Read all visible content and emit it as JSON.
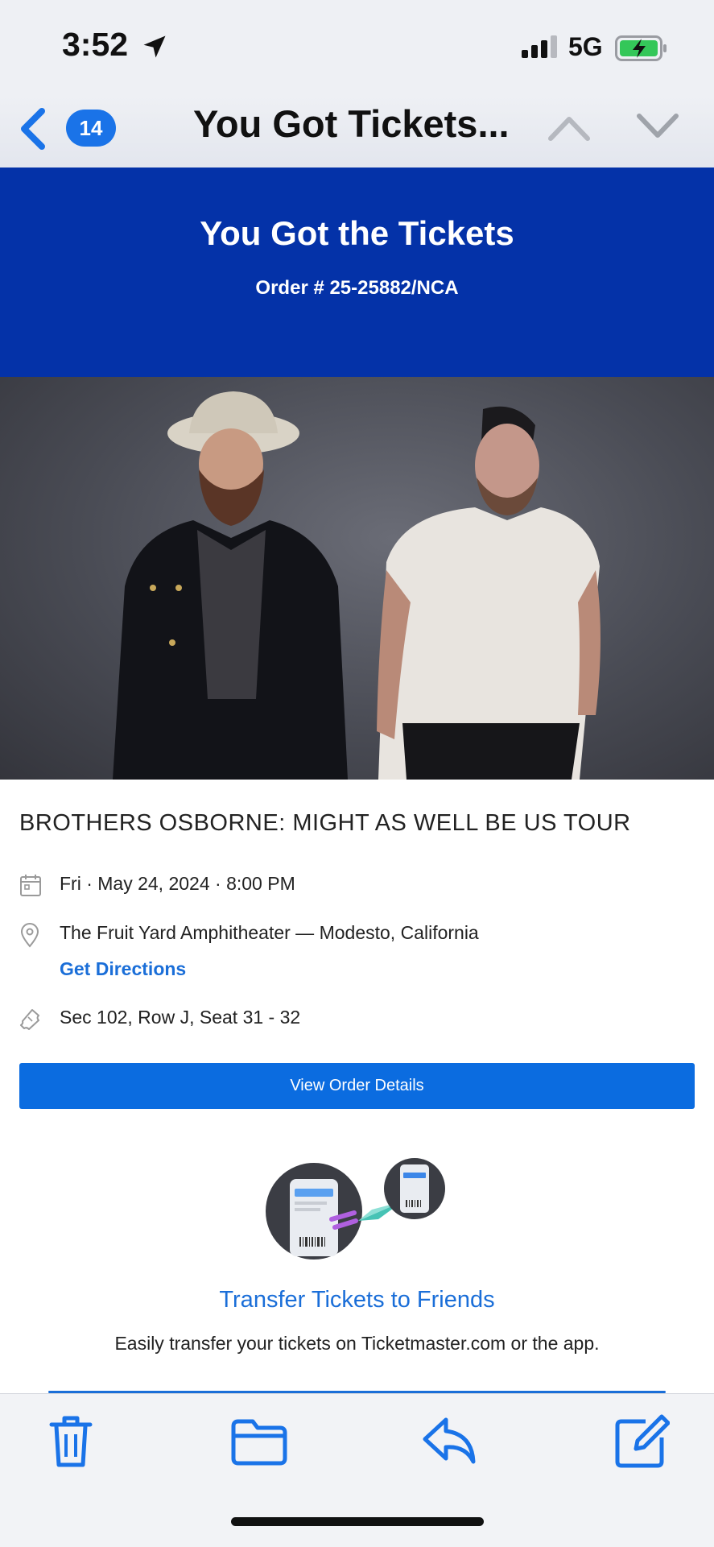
{
  "status_bar": {
    "time": "3:52",
    "network": "5G",
    "icons": [
      "location-arrow-icon",
      "signal-icon",
      "battery-charging-icon"
    ],
    "battery_color": "#34c759"
  },
  "nav": {
    "back_icon": "chevron-left-icon",
    "unread_count": "14",
    "title": "You Got Tickets...",
    "up_icon": "chevron-up-icon",
    "down_icon": "chevron-down-icon"
  },
  "banner": {
    "title": "You Got the Tickets",
    "order": "Order # 25-25882/NCA",
    "color": "#0432a8"
  },
  "event": {
    "title": "BROTHERS OSBORNE: MIGHT AS WELL BE US TOUR",
    "date": "Fri · May 24, 2024 · 8:00 PM",
    "venue": "The Fruit Yard Amphitheater — Modesto, California",
    "directions_link": "Get Directions",
    "seats": "Sec 102, Row J, Seat 31 - 32",
    "icons": [
      "calendar-icon",
      "location-pin-icon",
      "ticket-icon"
    ]
  },
  "actions": {
    "view_order": "View Order Details",
    "accent": "#0b6ce0"
  },
  "transfer": {
    "title": "Transfer Tickets to Friends",
    "description": "Easily transfer your tickets on Ticketmaster.com or the app."
  },
  "toolbar": {
    "icons": [
      "trash-icon",
      "folder-icon",
      "reply-icon",
      "compose-icon"
    ]
  }
}
